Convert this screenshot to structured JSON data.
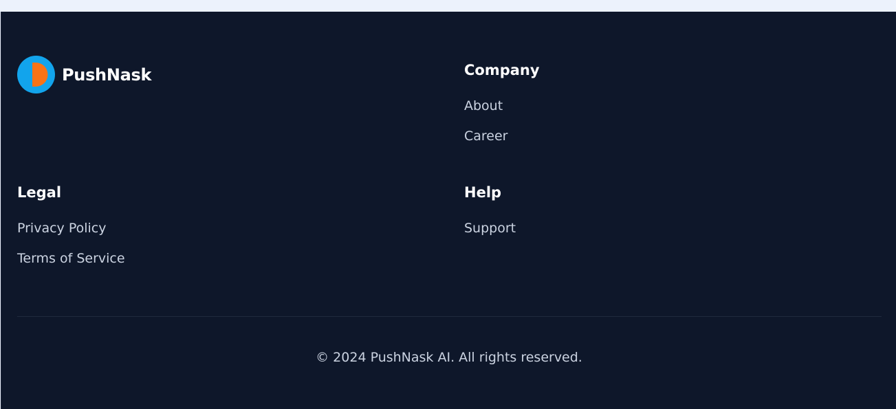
{
  "brand": {
    "name": "PushNask",
    "logo_colors": {
      "outer": "#12a4ec",
      "inner": "#f97316"
    }
  },
  "columns": {
    "company": {
      "title": "Company",
      "links": [
        "About",
        "Career"
      ]
    },
    "legal": {
      "title": "Legal",
      "links": [
        "Privacy Policy",
        "Terms of Service"
      ]
    },
    "help": {
      "title": "Help",
      "links": [
        "Support"
      ]
    }
  },
  "copyright": "© 2024 PushNask AI. All rights reserved.",
  "colors": {
    "footer_bg": "#0e172a",
    "heading": "#ffffff",
    "link": "#cbd3e1"
  }
}
